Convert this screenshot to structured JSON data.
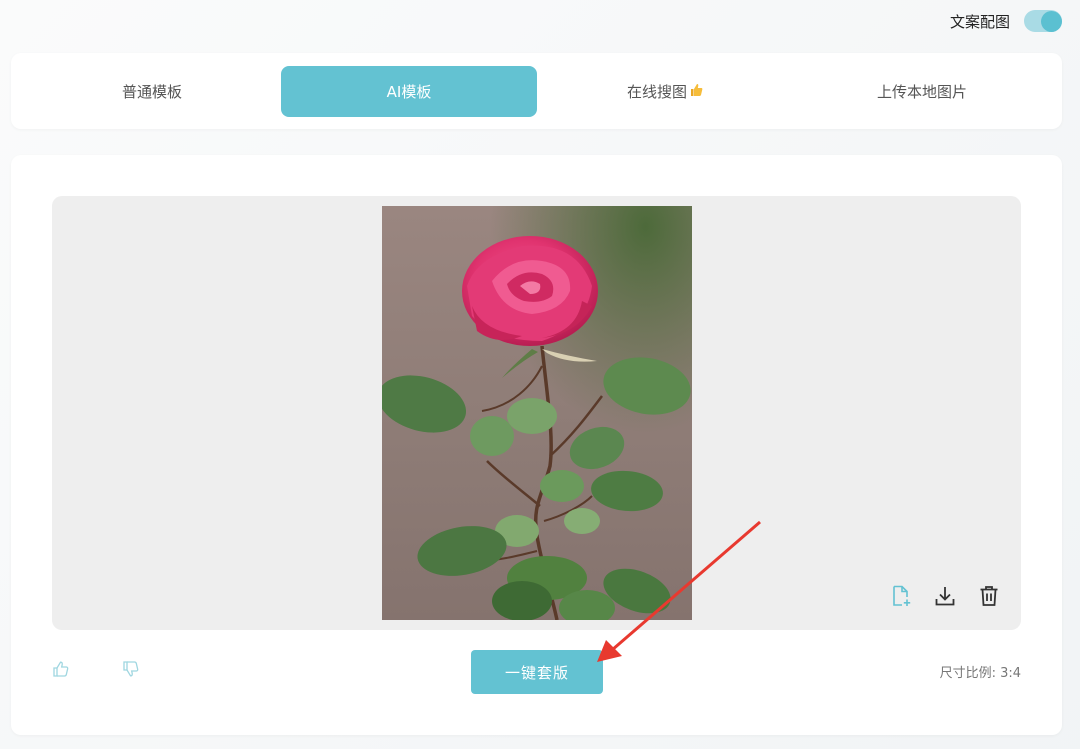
{
  "toolbar": {
    "copy_image_label": "文案配图",
    "copy_image_enabled": true
  },
  "tabs": [
    {
      "label": "普通模板",
      "active": false
    },
    {
      "label": "AI模板",
      "active": true
    },
    {
      "label": "在线搜图",
      "active": false,
      "icon": "thumbs-up-emoji"
    },
    {
      "label": "上传本地图片",
      "active": false
    }
  ],
  "preview": {
    "actions": [
      "add-file-icon",
      "download-icon",
      "delete-icon"
    ]
  },
  "footer": {
    "apply_button_label": "一键套版",
    "ratio_text": "尺寸比例: 3:4"
  },
  "colors": {
    "accent": "#63c2d2",
    "annotation_arrow": "#e8392f"
  }
}
